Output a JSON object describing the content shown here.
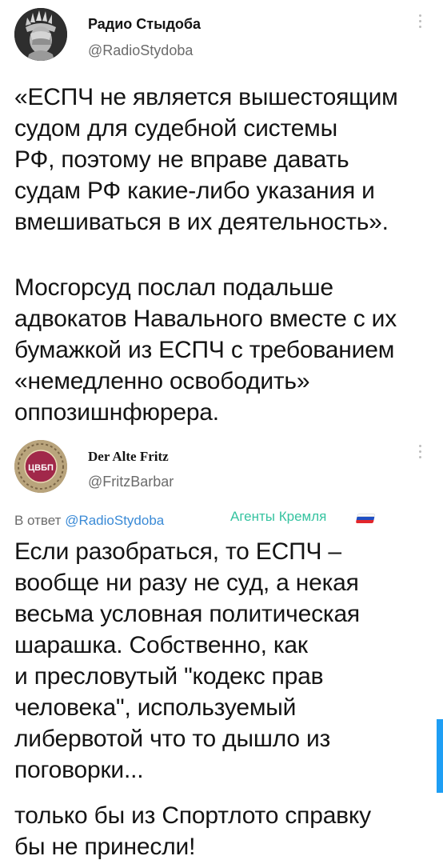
{
  "tweet1": {
    "author_name": "Радио Стыдоба",
    "author_handle": "@RadioStydoba",
    "text_paragraph_1": "«ЕСПЧ не является вышестоящим\nсудом для судебной системы\nРФ, поэтому не вправе давать\nсудам РФ какие-либо указания и\nвмешиваться в их деятельность».",
    "text_paragraph_2": "Мосгорсуд послал подальше\nадвокатов Навального вместе с их\nбумажкой из ЕСПЧ с требованием\n«немедленно освободить»\noппозишнфюрера."
  },
  "tweet2": {
    "author_name": "Der Alte Fritz",
    "author_handle": "@FritzBarbar",
    "avatar_text": "ЦВБП",
    "reply_prefix": "В ответ",
    "reply_mention": "@RadioStydoba",
    "agent_label": "Агенты Кремля",
    "flag_colors": [
      "#ffffff",
      "#1f4fc4",
      "#e2262b"
    ],
    "text_paragraph_1": "Если разобраться, то ЕСПЧ –\nвообще ни разу не суд, а некая\nвесьма условная политическая\nшарашка. Собственно, как\nи пресловутый \"кодекс прав\nчеловека\", используемый\nлибервотой что то дышло из\nпоговорки...",
    "text_paragraph_2": "только бы из Спортлото справку\nбы не принесли!"
  },
  "icons": {
    "more": "more-vertical-icon",
    "avatar1": "statue-of-liberty-facepalm-icon",
    "avatar2": "cvbp-badge-icon"
  },
  "colors": {
    "handle": "#6b6b6b",
    "mention": "#3a8ad6",
    "agent_label": "#35c3a0",
    "scroll_indicator": "#1e9ef4"
  }
}
